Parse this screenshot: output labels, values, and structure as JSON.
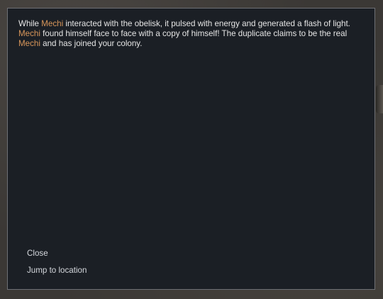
{
  "dialog": {
    "message_parts": {
      "p1": "While ",
      "name1": "Mechi",
      "p2": " interacted with the obelisk, it pulsed with energy and generated a flash of light. ",
      "name2": "Mechi",
      "p3": " found himself face to face with a copy of himself! The duplicate claims to be the real ",
      "name3": "Mechi",
      "p4": " and has joined your colony."
    },
    "options": {
      "close": "Close",
      "jump": "Jump to location"
    }
  },
  "colors": {
    "panel_background": "#1b1f25",
    "panel_border": "#6e7075",
    "highlight_name": "#d8965a",
    "body_text": "#e6e6e6"
  }
}
